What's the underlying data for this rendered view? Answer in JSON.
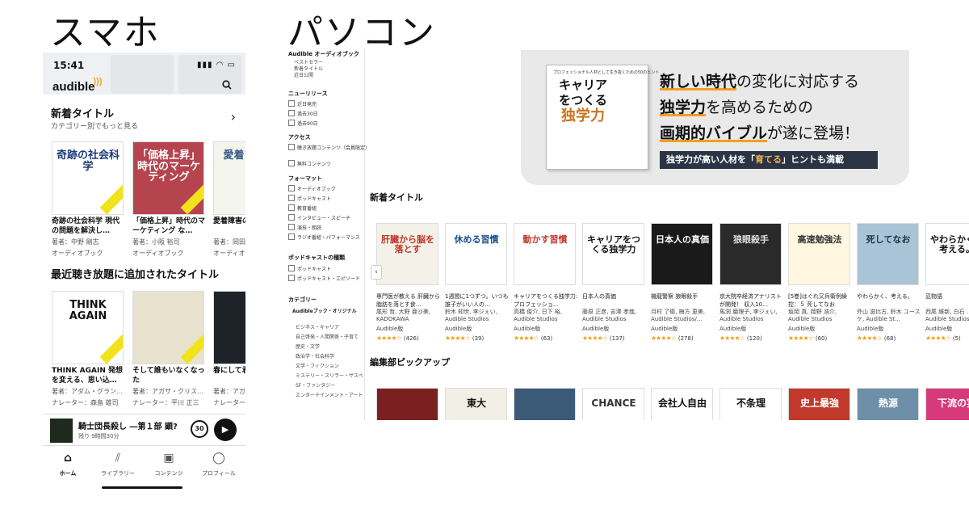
{
  "headings": {
    "phone": "スマホ",
    "pc": "パソコン"
  },
  "phone": {
    "status_time": "15:41",
    "status_icons": "▮▮▮ ◠ ▭",
    "logo": "audible",
    "search_icon": "search-icon",
    "new_titles": {
      "title": "新着タイトル",
      "subtitle": "カテゴリー別でもっと見る"
    },
    "books_row1": [
      {
        "cover_text": "奇跡の社会科学",
        "title": "奇跡の社会科学 現代の問題を解決し…",
        "author": "著者：中野 剛志",
        "meta": "オーディオブック",
        "bg": "#ffffff",
        "fg": "#1a3c7a"
      },
      {
        "cover_text": "「価格上昇」時代のマーケティング",
        "title": "「価格上昇」時代のマーケティング な…",
        "author": "著者：小阪 裕司",
        "meta": "オーディオブック",
        "bg": "#b5444e",
        "fg": "#ffffff"
      },
      {
        "cover_text": "愛着アプロ",
        "title": "愛着障害の着アプロー",
        "author": "著者：岡田",
        "meta": "オーディオ",
        "bg": "#f4f6ee",
        "fg": "#3a5a8a"
      }
    ],
    "unlimited": {
      "title": "最近聴き放題に追加されたタイトル"
    },
    "books_row2": [
      {
        "cover_text": "THINK AGAIN",
        "title": "THINK AGAIN 発想を変える、思い込…",
        "author": "著者：アダム・グラン…",
        "meta": "ナレーター：森島 雄司",
        "bg": "#ffffff",
        "fg": "#111111"
      },
      {
        "cover_text": "",
        "title": "そして誰もいなくなった",
        "author": "著者：アガサ・クリス…",
        "meta": "ナレーター：平川 正三",
        "bg": "#e9e2cf",
        "fg": "#7a3a2a"
      },
      {
        "cover_text": "",
        "title": "春にして君",
        "author": "著者：アガ",
        "meta": "ナレーター",
        "bg": "#1d2328",
        "fg": "#ffffff"
      }
    ],
    "player": {
      "title": "騎士団長殺し ―第１部 顕?",
      "remaining": "残り 9時間30分",
      "skip": "30"
    },
    "tabs": [
      {
        "icon": "⌂",
        "label": "ホーム",
        "active": true
      },
      {
        "icon": "⫽",
        "label": "ライブラリー",
        "active": false
      },
      {
        "icon": "▣",
        "label": "コンテンツ",
        "active": false
      },
      {
        "icon": "◯",
        "label": "プロフィール",
        "active": false
      }
    ]
  },
  "desktop": {
    "sidebar": {
      "audible_head": "Audible オーディオブック",
      "audible_items": [
        "ベストセラー",
        "新着タイトル",
        "近日公開"
      ],
      "release_head": "ニューリリース",
      "release_items": [
        "近日発売",
        "過去30日",
        "過去90日"
      ],
      "access_head": "アクセス",
      "access_items": [
        "聴き放題コンテンツ（会員限定）",
        "無料コンテンツ"
      ],
      "format_head": "フォーマット",
      "format_items": [
        "オーディオブック",
        "ポッドキャスト",
        "教育番組",
        "インタビュー・スピーチ",
        "演技・朗読",
        "ラジオ番組・パフォーマンス"
      ],
      "podcast_head": "ポッドキャストの種類",
      "podcast_items": [
        "ポッドキャスト",
        "ポッドキャスト・エピソード"
      ],
      "category_head": "カテゴリー",
      "category_sub": "Audibleブック・オリジナル",
      "category_items": [
        "ビジネス・キャリア",
        "自己啓発・人間関係・子育て",
        "歴史・文学",
        "政治学・社会科学",
        "文学・フィクション",
        "ミステリー・スリラー・サスペンス",
        "SF・ファンタジー",
        "エンターテインメント・アート"
      ]
    },
    "banner": {
      "cover_small": "プロフェッショナル人材として生き抜くための50のヒント",
      "cover_title_a": "キャリア",
      "cover_title_b": "をつくる",
      "cover_title_c": "独学力",
      "line1_a": "新しい時代",
      "line1_b": "の変化に対応する",
      "line2_a": "独学力",
      "line2_b": "を高めるための",
      "line3_a": "画期的バイブル",
      "line3_b": "が遂に登場！",
      "bar_a": "独学力が高い人材を「",
      "bar_b": "育てる",
      "bar_c": "」ヒントも満載"
    },
    "new_section": "新着タイトル",
    "new_books": [
      {
        "cover_text": "肝臓から脳を落とす",
        "title": "専門医が教える 肝臓から脂肪を落とす食…",
        "author": "尾形 哲, 大野 亜沙美, KADOKAWA",
        "pub": "Audible版",
        "stars": "★★★★☆",
        "count": "(426)",
        "bg": "#f4f1e8",
        "fg": "#c0392b"
      },
      {
        "cover_text": "休める習慣",
        "title": "1週間に1つずつ。いつも誰子がいい人の…",
        "author": "鈴木 知世, 李ジぇい, Audible Studios",
        "pub": "Audible版",
        "stars": "★★★★☆",
        "count": "(39)",
        "bg": "#ffffff",
        "fg": "#1c4f8c"
      },
      {
        "cover_text": "動かす習慣",
        "title": "キャリアをつくる独学力: プロフェッショ…",
        "author": "高橋 俊介, 日下 裕, Audible Studios",
        "pub": "Audible版",
        "stars": "★★★★☆",
        "count": "(63)",
        "bg": "#ffffff",
        "fg": "#c0392b"
      },
      {
        "cover_text": "キャリアをつくる独学力",
        "title": "日本人の真価",
        "author": "藤原 正彦, 吉澤 孝哉, Audible Studios",
        "pub": "Audible版",
        "stars": "★★★★☆",
        "count": "(137)",
        "bg": "#ffffff",
        "fg": "#111111"
      },
      {
        "cover_text": "日本人の真価",
        "title": "機龍警察 狼眼殺手",
        "author": "月村 了衛, 梅方 恵美, Audible Studios/…",
        "pub": "Audible版",
        "stars": "★★★★☆",
        "count": "(278)",
        "bg": "#1a1a1a",
        "fg": "#ffffff"
      },
      {
        "cover_text": "狼眼殺手",
        "title": "京大院卒経済アナリストが開発！ 収入10…",
        "author": "馬渕 磨理子, 李ジぇい, Audible Studios",
        "pub": "Audible版",
        "stars": "★★★★☆",
        "count": "(120)",
        "bg": "#2a2a2a",
        "fg": "#dddddd"
      },
      {
        "cover_text": "高速勉強法",
        "title": "[5巻]はぐれ又兵衛例繰控：５ 死してなお",
        "author": "坂岡 真, 岡野 浩介, Audible Studios",
        "pub": "Audible版",
        "stars": "★★★★☆",
        "count": "(60)",
        "bg": "#fff7e0",
        "fg": "#333333"
      },
      {
        "cover_text": "死してなお",
        "title": "やわらかく、考える。",
        "author": "外山 滋比古, 鈴木 ユースケ, Audible St…",
        "pub": "Audible版",
        "stars": "★★★★☆",
        "count": "(68)",
        "bg": "#a9c4d6",
        "fg": "#223344"
      },
      {
        "cover_text": "やわらかく、考える。",
        "title": "忍物語",
        "author": "西尾 維新, 白石 …, Audible Studios",
        "pub": "Audible版",
        "stars": "★★★★☆",
        "count": "(5)",
        "bg": "#ffffff",
        "fg": "#111111"
      },
      {
        "cover_text": "",
        "title": "",
        "author": "",
        "pub": "",
        "stars": "",
        "count": "",
        "bg": "#dde2e6",
        "fg": "#333333"
      }
    ],
    "picks_section": "編集部ピックアップ",
    "picks": [
      {
        "cover_text": "",
        "bg": "#7a2020",
        "fg": "#ffffff"
      },
      {
        "cover_text": "東大",
        "bg": "#f2efe6",
        "fg": "#111111"
      },
      {
        "cover_text": "",
        "bg": "#3a5a78",
        "fg": "#ffffff"
      },
      {
        "cover_text": "CHANCE",
        "bg": "#ffffff",
        "fg": "#333333"
      },
      {
        "cover_text": "会社人自由",
        "bg": "#ffffff",
        "fg": "#111111"
      },
      {
        "cover_text": "不条理",
        "bg": "#ffffff",
        "fg": "#111111"
      },
      {
        "cover_text": "史上最強",
        "bg": "#c0392b",
        "fg": "#ffffff"
      },
      {
        "cover_text": "熱源",
        "bg": "#6d8fa8",
        "fg": "#ffffff"
      },
      {
        "cover_text": "下流の宴",
        "bg": "#d63a7a",
        "fg": "#ffffff"
      },
      {
        "cover_text": "",
        "bg": "#2aa0c8",
        "fg": "#ffffff"
      }
    ]
  }
}
